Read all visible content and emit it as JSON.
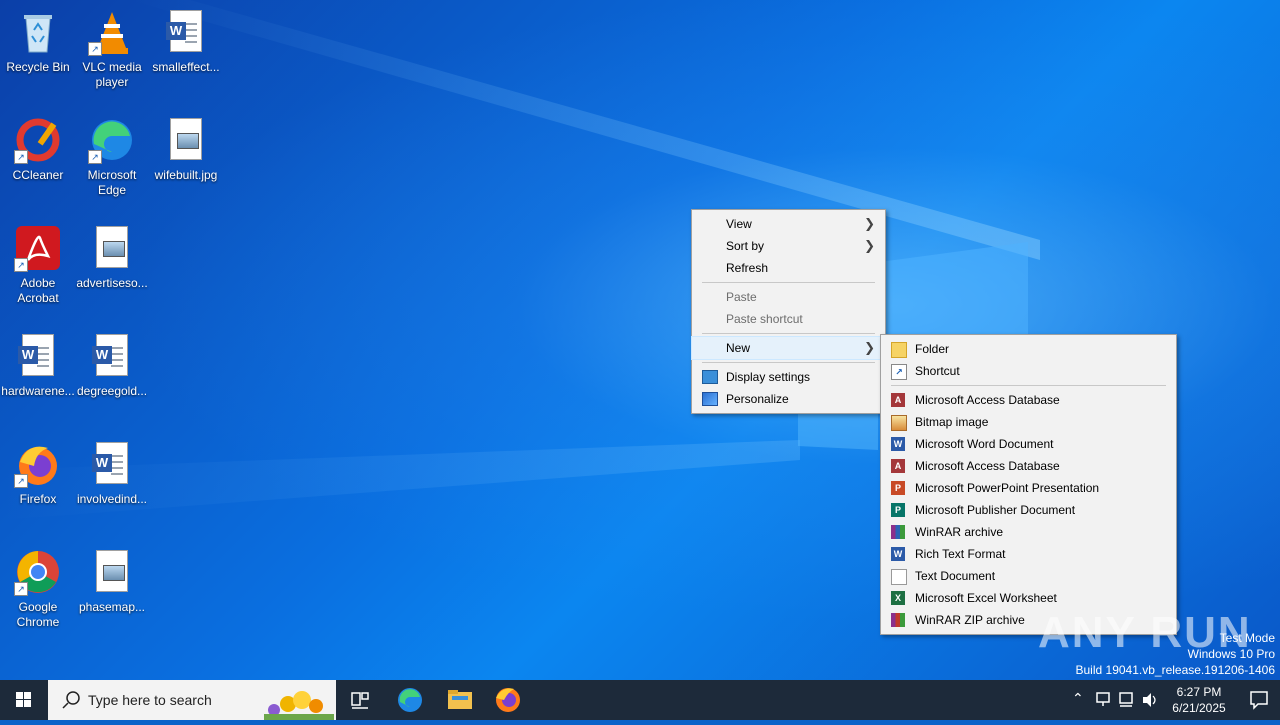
{
  "desktop": {
    "icons": [
      {
        "label": "Recycle Bin",
        "icon": "recycle-bin-icon"
      },
      {
        "label": "VLC media player",
        "icon": "vlc-icon"
      },
      {
        "label": "smalleffect...",
        "icon": "word-doc-icon"
      },
      {
        "label": "CCleaner",
        "icon": "ccleaner-icon"
      },
      {
        "label": "Microsoft Edge",
        "icon": "edge-icon"
      },
      {
        "label": "wifebuilt.jpg",
        "icon": "image-file-icon"
      },
      {
        "label": "Adobe Acrobat",
        "icon": "acrobat-icon"
      },
      {
        "label": "advertiseso...",
        "icon": "image-file-icon"
      },
      {
        "label": "hardwarene...",
        "icon": "word-doc-icon"
      },
      {
        "label": "degreegold...",
        "icon": "word-doc-icon"
      },
      {
        "label": "Firefox",
        "icon": "firefox-icon"
      },
      {
        "label": "involvedind...",
        "icon": "word-doc-icon"
      },
      {
        "label": "Google Chrome",
        "icon": "chrome-icon"
      },
      {
        "label": "phasemap...",
        "icon": "image-file-icon"
      }
    ]
  },
  "context_menu": {
    "items": [
      {
        "label": "View",
        "has_submenu": true
      },
      {
        "label": "Sort by",
        "has_submenu": true
      },
      {
        "label": "Refresh"
      },
      {
        "label": "Paste",
        "disabled": true
      },
      {
        "label": "Paste shortcut",
        "disabled": true
      },
      {
        "label": "New",
        "has_submenu": true,
        "highlighted": true
      },
      {
        "label": "Display settings",
        "icon": "display-settings-icon"
      },
      {
        "label": "Personalize",
        "icon": "personalize-icon"
      }
    ]
  },
  "new_submenu": {
    "items": [
      {
        "label": "Folder",
        "icon": "folder-icon"
      },
      {
        "label": "Shortcut",
        "icon": "shortcut-icon"
      },
      {
        "label": "Microsoft Access Database",
        "icon": "access-icon"
      },
      {
        "label": "Bitmap image",
        "icon": "bitmap-icon"
      },
      {
        "label": "Microsoft Word Document",
        "icon": "word-icon"
      },
      {
        "label": "Microsoft Access Database",
        "icon": "access-icon"
      },
      {
        "label": "Microsoft PowerPoint Presentation",
        "icon": "powerpoint-icon"
      },
      {
        "label": "Microsoft Publisher Document",
        "icon": "publisher-icon"
      },
      {
        "label": "WinRAR archive",
        "icon": "winrar-icon"
      },
      {
        "label": "Rich Text Format",
        "icon": "rtf-icon"
      },
      {
        "label": "Text Document",
        "icon": "text-doc-icon"
      },
      {
        "label": "Microsoft Excel Worksheet",
        "icon": "excel-icon"
      },
      {
        "label": "WinRAR ZIP archive",
        "icon": "winrar-zip-icon"
      }
    ]
  },
  "watermark": {
    "brand": "ANY RUN",
    "line1": "Test Mode",
    "line2": "Windows 10 Pro",
    "line3": "Build 19041.vb_release.191206-1406"
  },
  "taskbar": {
    "search_placeholder": "Type here to search",
    "clock_time": "6:27 PM",
    "clock_date": "6/21/2025",
    "pinned": [
      "task-view-icon",
      "edge-icon",
      "file-explorer-icon",
      "firefox-icon"
    ]
  },
  "colors": {
    "taskbar": "#1d2a3a",
    "menu_bg": "#f2f2f2",
    "highlight": "#e5f1fb"
  }
}
